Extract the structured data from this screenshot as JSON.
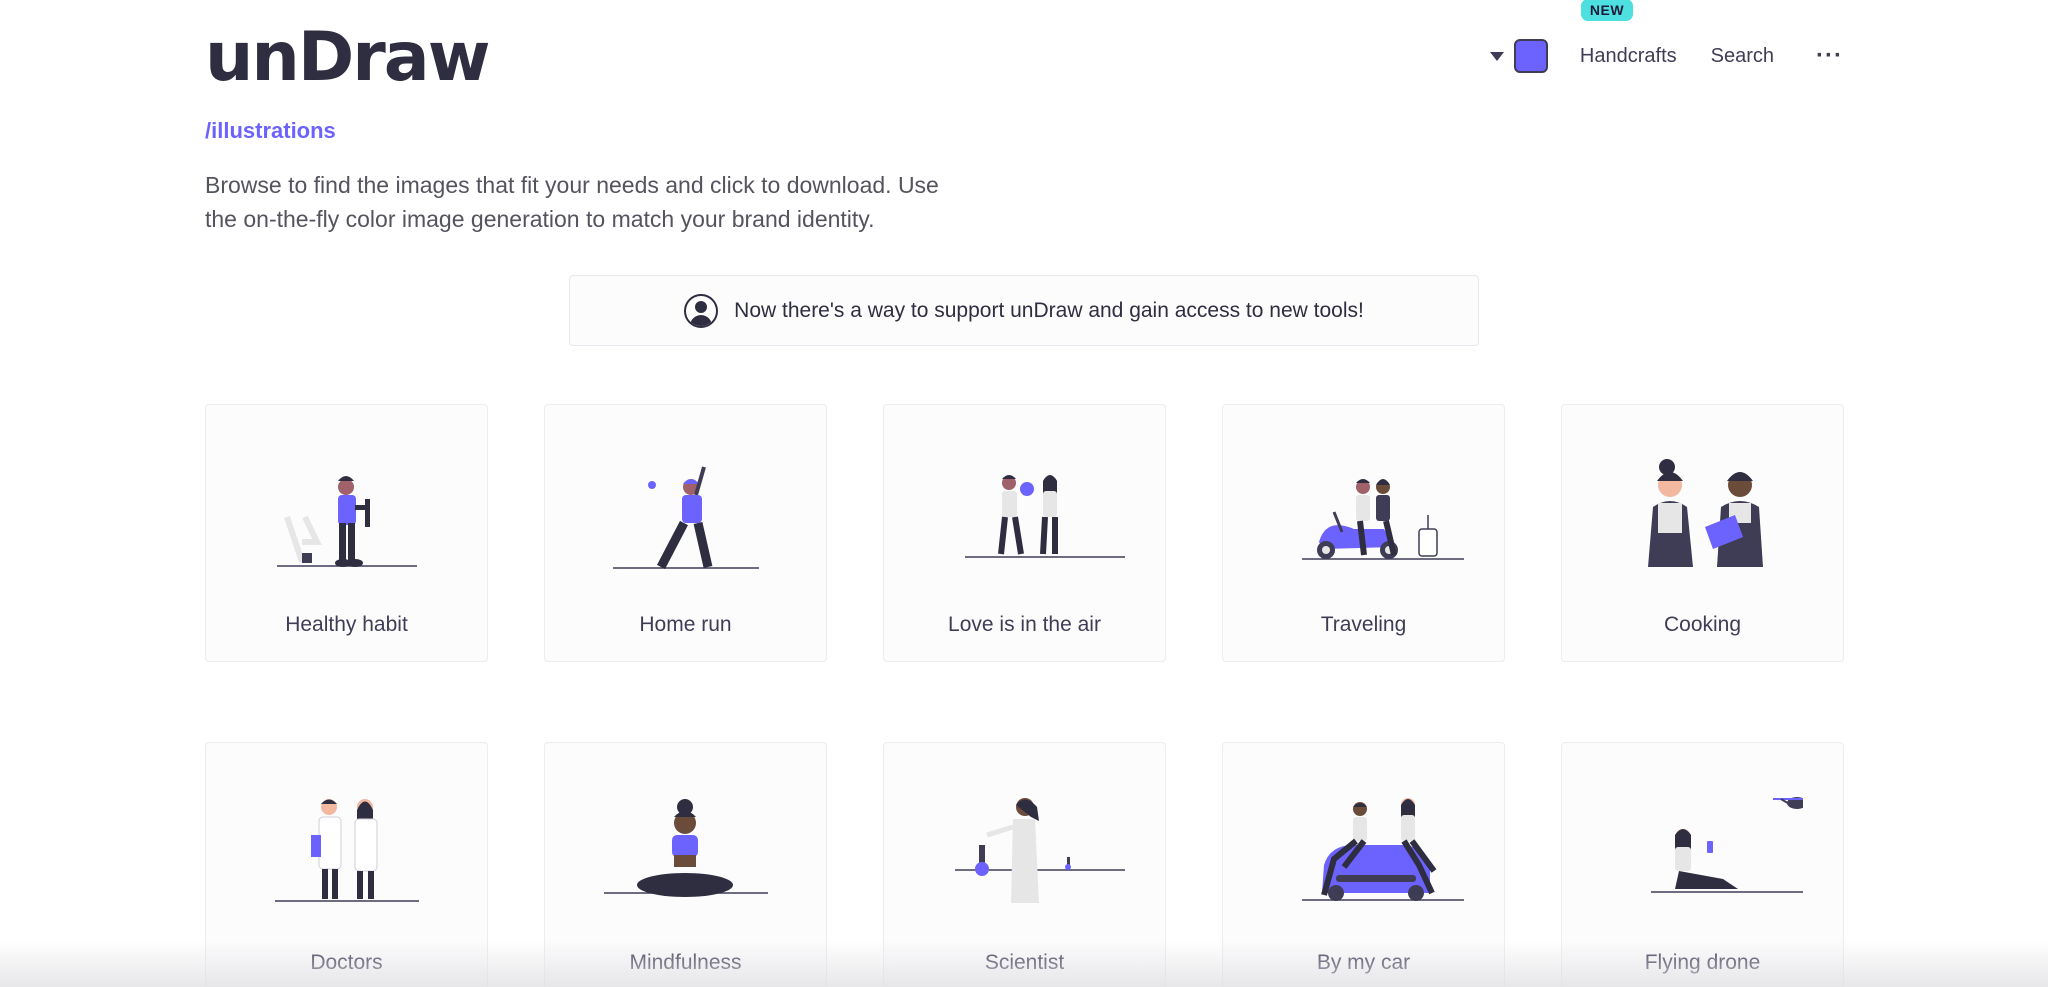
{
  "app": {
    "logo": "unDraw",
    "section": "/illustrations"
  },
  "nav": {
    "color_accent": "#6c63ff",
    "badge": "NEW",
    "handcrafts": "Handcrafts",
    "search": "Search",
    "more": "···"
  },
  "intro": {
    "line1": "Browse to find the images that fit your needs and click to download. Use",
    "line2": "the on-the-fly color image generation to match your brand identity."
  },
  "banner": {
    "text": "Now there's a way to support unDraw and gain access to new tools!"
  },
  "illustrations": [
    {
      "title": "Healthy habit"
    },
    {
      "title": "Home run"
    },
    {
      "title": "Love is in the air"
    },
    {
      "title": "Traveling"
    },
    {
      "title": "Cooking"
    },
    {
      "title": "Doctors"
    },
    {
      "title": "Mindfulness"
    },
    {
      "title": "Scientist"
    },
    {
      "title": "By my car"
    },
    {
      "title": "Flying drone"
    }
  ]
}
